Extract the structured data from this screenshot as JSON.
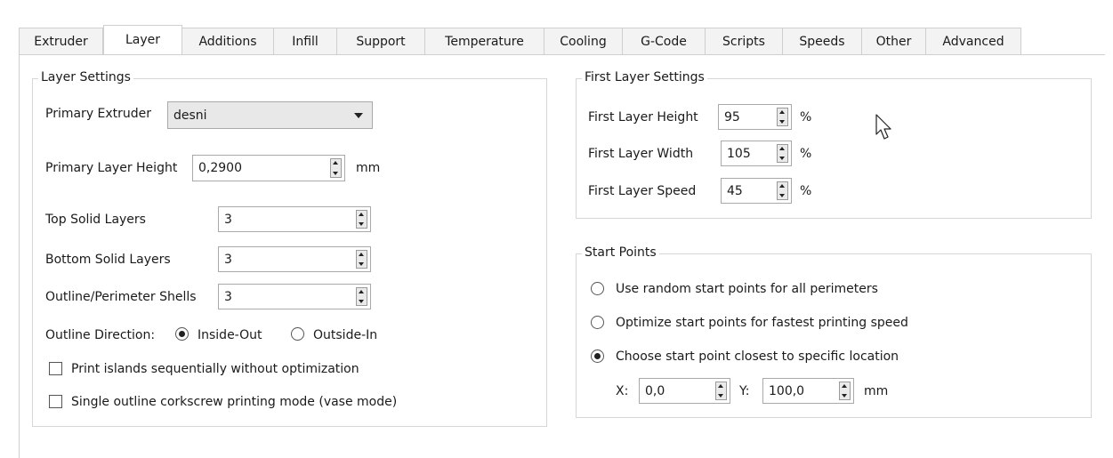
{
  "tabs": [
    "Extruder",
    "Layer",
    "Additions",
    "Infill",
    "Support",
    "Temperature",
    "Cooling",
    "G-Code",
    "Scripts",
    "Speeds",
    "Other",
    "Advanced"
  ],
  "active_tab": "Layer",
  "layer_settings": {
    "title": "Layer Settings",
    "primary_extruder_label": "Primary Extruder",
    "primary_extruder_value": "desni",
    "primary_layer_height_label": "Primary Layer Height",
    "primary_layer_height_value": "0,2900",
    "primary_layer_height_unit": "mm",
    "top_solid_layers_label": "Top Solid Layers",
    "top_solid_layers_value": "3",
    "bottom_solid_layers_label": "Bottom Solid Layers",
    "bottom_solid_layers_value": "3",
    "outline_shells_label": "Outline/Perimeter Shells",
    "outline_shells_value": "3",
    "outline_direction_label": "Outline Direction:",
    "inside_out_label": "Inside-Out",
    "outside_in_label": "Outside-In",
    "outline_direction_selected": "Inside-Out",
    "print_islands_label": "Print islands sequentially without optimization",
    "print_islands_checked": false,
    "vase_mode_label": "Single outline corkscrew printing mode (vase mode)",
    "vase_mode_checked": false
  },
  "first_layer_settings": {
    "title": "First Layer Settings",
    "height_label": "First Layer Height",
    "height_value": "95",
    "width_label": "First Layer Width",
    "width_value": "105",
    "speed_label": "First Layer Speed",
    "speed_value": "45",
    "unit": "%"
  },
  "start_points": {
    "title": "Start Points",
    "option_random": "Use random start points for all perimeters",
    "option_optimize": "Optimize start points for fastest printing speed",
    "option_closest": "Choose start point closest to specific location",
    "selected": "Choose start point closest to specific location",
    "x_label": "X:",
    "x_value": "0,0",
    "y_label": "Y:",
    "y_value": "100,0",
    "unit": "mm"
  },
  "icons": {
    "cursor": "mouse-pointer-icon"
  }
}
